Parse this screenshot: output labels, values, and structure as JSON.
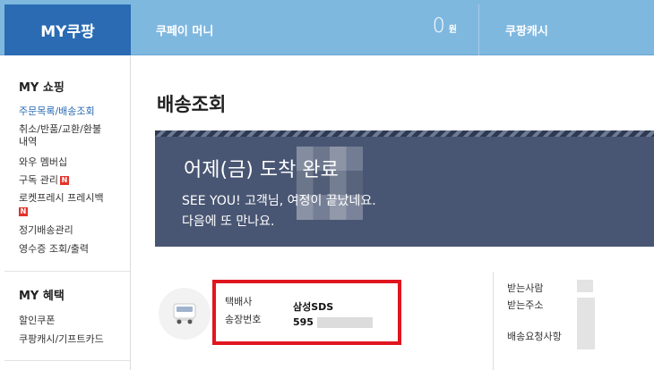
{
  "header": {
    "brand": "MY쿠팡",
    "wallet_label": "쿠페이 머니",
    "wallet_amount": "0",
    "wallet_unit": "원",
    "cash_label": "쿠팡캐시"
  },
  "sidebar": {
    "shopping_title": "MY 쇼핑",
    "shopping_items": [
      {
        "label": "주문목록/배송조회"
      },
      {
        "label": "취소/반품/교환/환불"
      },
      {
        "label": "내역"
      },
      {
        "label": "와우 멤버십"
      },
      {
        "label": "구독 관리"
      },
      {
        "label": "로켓프레시 프레시백"
      },
      {
        "label": "정기배송관리"
      },
      {
        "label": "영수증 조회/출력"
      }
    ],
    "badge": "N",
    "benefit_title": "MY 혜택",
    "benefit_items": [
      {
        "label": "할인쿠폰"
      },
      {
        "label": "쿠팡캐시/기프트카드"
      }
    ]
  },
  "main": {
    "title": "배송조회",
    "banner": {
      "headline": "어제(금) 도착 완료",
      "line1": "SEE YOU! 고객님, 여정이 끝났네요.",
      "line2": "다음에 또 만나요."
    },
    "carrier_label": "택배사",
    "carrier_value": "삼성SDS",
    "tracking_label": "송장번호",
    "tracking_value": "595",
    "receiver_label": "받는사람",
    "address_label": "받는주소",
    "request_label": "배송요청사항"
  },
  "colors": {
    "brand_blue": "#2a6bb3",
    "topbar": "#7fb8df",
    "banner": "#495673",
    "highlight_red": "#e0161f"
  }
}
